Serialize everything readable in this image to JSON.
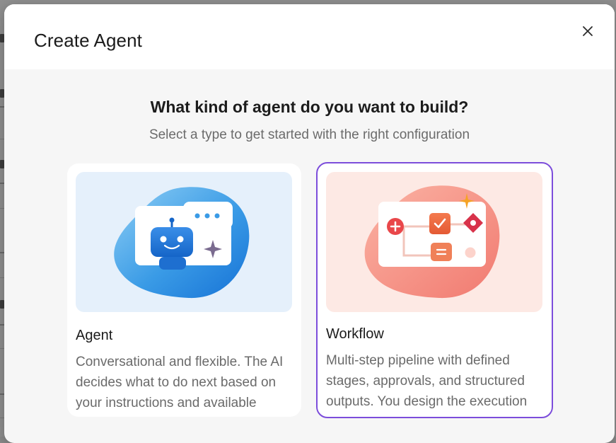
{
  "dialog": {
    "title": "Create Agent",
    "close_icon": "close-icon"
  },
  "prompt": {
    "heading": "What kind of agent do you want to build?",
    "subheading": "Select a type to get started with the right configuration"
  },
  "options": [
    {
      "title": "Agent",
      "description": "Conversational and flexible. The AI decides what to do next based on your instructions and available",
      "illustration": "robot-chat-icon",
      "background": "#e5f0fb",
      "selected": false
    },
    {
      "title": "Workflow",
      "description": "Multi-step pipeline with defined stages, approvals, and structured outputs. You design the execution",
      "illustration": "workflow-steps-icon",
      "background": "#fde9e4",
      "selected": true
    }
  ],
  "colors": {
    "selected_border": "#7c4ddb"
  }
}
